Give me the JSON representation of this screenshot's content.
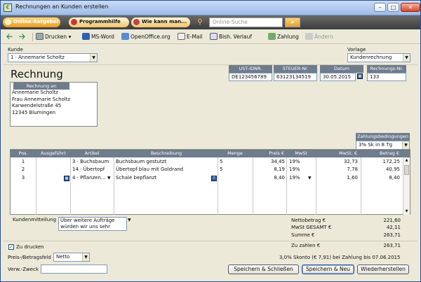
{
  "window": {
    "title": "Rechnungen an Kunden erstellen"
  },
  "linkbar": {
    "tabs": [
      "Online-Ratgeber",
      "Programmhilfe",
      "Wie kann man..."
    ],
    "search_placeholder": "Online-Suche",
    "go": "»"
  },
  "toolbar": {
    "print": "Drucken",
    "msword": "MS-Word",
    "openoffice": "OpenOffice.org",
    "email": "E-Mail",
    "history": "Bish. Verlauf",
    "payment": "Zahlung",
    "change": "Ändern"
  },
  "form": {
    "kunde_label": "Kunde",
    "kunde_value": "1 · Annemarie Scholtz",
    "vorlage_label": "Vorlage",
    "vorlage_value": "Kundenrechnung",
    "doc_title": "Rechnung",
    "ust_label": "UST-IDNR.",
    "ust_value": "DE123456789",
    "steuer_label": "STEUER-Nr.",
    "steuer_value": "63123134519",
    "datum_label": "Datum",
    "datum_value": "30.05.2015",
    "rnr_label": "Rechnungs-Nr.",
    "rnr_value": "133",
    "address_header": "Rechnung an",
    "address_lines": [
      "Annemarie Scholtz",
      "Frau Annemarie Scholtz",
      "Karwendelstraße 45",
      "12345 Blumingen"
    ],
    "terms_label": "Zahlungsbedingungen",
    "terms_value": "3% Sk in 8 Tg"
  },
  "table": {
    "headers": [
      "Pos.",
      "Ausgeführt",
      "Artikel",
      "Beschreibung",
      "Menge",
      "Preis €",
      "MwSt",
      "MwSt. €",
      "Betrag €"
    ],
    "rows": [
      {
        "pos": "1",
        "artikel": "3 · Buchsbaum",
        "desc": "Buchsbaum gestutzt",
        "menge": "5",
        "preis": "34,45",
        "mwst": "19%",
        "mwst_eur": "32,73",
        "betrag": "172,25"
      },
      {
        "pos": "2",
        "artikel": "14 · Übertopf",
        "desc": "Übertopf blau mit Goldrand",
        "menge": "5",
        "preis": "8,19",
        "mwst": "19%",
        "mwst_eur": "7,78",
        "betrag": "40,95"
      },
      {
        "pos": "3",
        "artikel": "4 · Pflanzen...",
        "desc": "Schale bepflanzt",
        "menge": "",
        "preis": "8,40",
        "mwst": "19%",
        "mwst_eur": "1,60",
        "betrag": "8,40"
      }
    ]
  },
  "bottom": {
    "memo_label": "Kundenmitteilung",
    "memo_value": "Über weitere Aufträge würden wir uns sehr",
    "netto_label": "Nettobetrag €",
    "netto_value": "221,60",
    "mwst_label": "MwSt GESAMT €",
    "mwst_value": "42,11",
    "summe_label": "Summe €",
    "summe_value": "263,71",
    "zuzahlen_label": "Zu zahlen €",
    "zuzahlen_value": "263,71",
    "print_label": "Zu drucken",
    "skonto_text": "3,0% Skonto (€ 7,91) bei Zahlung bis 07.06.2015",
    "preisfeld_label": "Preis-/Betragsfeld",
    "preisfeld_value": "Netto",
    "zweck_label": "Verw.-Zweck",
    "zweck_value": "",
    "btn_save_close": "Speichern & Schließen",
    "btn_save_new": "Speichern & Neu",
    "btn_restore": "Wiederherstellen"
  },
  "colors": {
    "header_gray": "#6f7c8c",
    "accent_orange": "#f0a030",
    "frame_blue": "#2a4f95"
  }
}
